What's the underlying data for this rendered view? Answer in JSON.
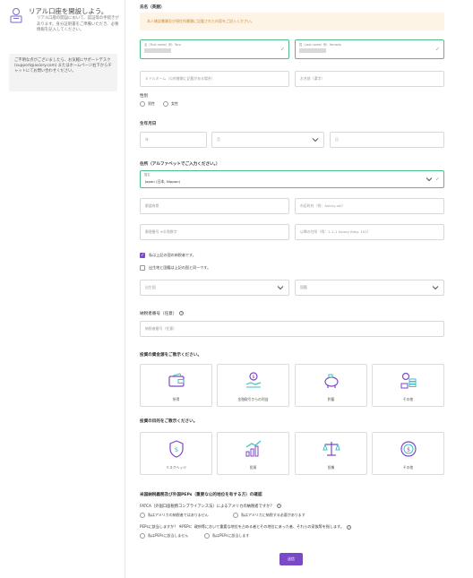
{
  "sidebar": {
    "title": "リアル口座を開設しよう。",
    "description": "リアル口座の開設において、認証等の手続きがあります。身分証明書をご準備いただき、必要情報を記入してください。",
    "help": "ご不明な点がございましたら、お気軽にサポートデスク (support@axiory.com) またはホームページ右下からチャットにてお問い合わせください。"
  },
  "name_section": {
    "heading": "氏名（英語）",
    "notice": "本人確認書類及び現住所書類に記載された内容をご記入ください。",
    "first_name_label": "名（First name）例：Taro",
    "last_name_label": "姓（Last name）例：Yamada",
    "middle_name_placeholder": "ミドルネーム（公的書類に記載がある場合）",
    "kanji_name_placeholder": "お名前（漢字）"
  },
  "gender": {
    "label": "性別",
    "options": [
      "男性",
      "女性"
    ]
  },
  "birth": {
    "heading": "生年月日",
    "year": "年",
    "month": "月",
    "day": "日"
  },
  "address": {
    "heading": "住所（アルファベットでご入力ください。）",
    "country_label": "国名",
    "country_value": "Japan (日本, Nippon)",
    "prefecture": "都道府県",
    "city": "市区町村（例：Axiory-shi）",
    "postal": "郵便番号 ※半角数字",
    "street": "以降の住所（例：1-1-1 Axiory Bldg. 101）",
    "tax_resident_check": "私は上記の国の納税者です。",
    "birthplace_check": "出生地と国籍は上記の国と同一です。",
    "birth_country": "出生国",
    "nationality": "国籍"
  },
  "tax": {
    "label": "納税者番号（任意）",
    "placeholder": "納税者番号（任意）"
  },
  "funds": {
    "heading": "投資の資金源をご教示ください。",
    "options": [
      "所得",
      "金融取引からの利益",
      "貯蓄",
      "その他"
    ]
  },
  "purpose": {
    "heading": "投資の目的をご教示ください。",
    "options": [
      "リスクヘッジ",
      "投資",
      "投機",
      "その他"
    ]
  },
  "fatca": {
    "heading": "米国納税義務及び外国PEPs（重要な公的地位を有する方）の確認",
    "fatca_question": "FATCA（外国口座税務コンプライアンス法）によるアメリカの納税者ですか？",
    "fatca_no": "私はアメリカの納税者ではありません",
    "fatca_yes": "私はアメリカに納税する必要があります",
    "peps_question": "PEPsに該当しますか？ ※PEPs：政府等において重要な地位を占める者とその地位にあった者、それらの家族等を指します。",
    "peps_no": "私はPEPsに該当しません",
    "peps_yes": "私はPEPsに該当します"
  },
  "submit_label": "送信",
  "colors": {
    "accent": "#7a49c9",
    "valid": "#4dbf86",
    "notice_bg": "#fdf4e5",
    "notice_text": "#c98a3b"
  }
}
